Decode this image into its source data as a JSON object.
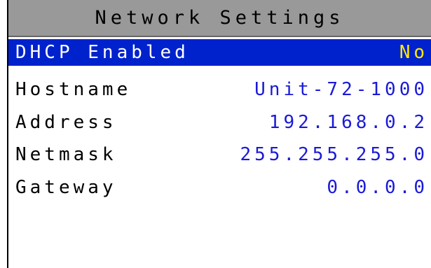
{
  "screen": {
    "title": "Network Settings"
  },
  "settings": [
    {
      "label": "DHCP Enabled",
      "value": "No",
      "selected": true
    },
    {
      "label": "Hostname",
      "value": "Unit-72-1000",
      "selected": false
    },
    {
      "label": "Address",
      "value": "192.168.0.2",
      "selected": false
    },
    {
      "label": "Netmask",
      "value": "255.255.255.0",
      "selected": false
    },
    {
      "label": "Gateway",
      "value": "0.0.0.0",
      "selected": false
    }
  ],
  "colors": {
    "title_background": "#999999",
    "selection_background": "#0022cc",
    "selected_label": "#ffffff",
    "selected_value": "#ffe800",
    "value_text": "#1a1ad8",
    "label_text": "#000000"
  }
}
